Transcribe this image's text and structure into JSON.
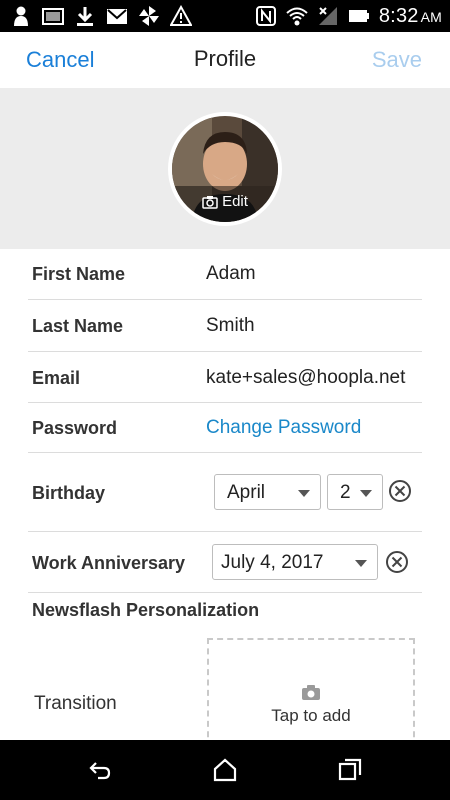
{
  "status_bar": {
    "time": "8:32",
    "ampm": "AM",
    "left_icons": [
      "person-icon",
      "image-icon",
      "download-icon",
      "gmail-icon",
      "pinwheel-icon",
      "warning-icon"
    ],
    "right_icons": [
      "nfc-icon",
      "wifi-icon",
      "signal-icon",
      "battery-icon"
    ]
  },
  "header": {
    "cancel": "Cancel",
    "title": "Profile",
    "save": "Save"
  },
  "avatar": {
    "edit_label": "Edit",
    "icon": "camera-icon"
  },
  "fields": {
    "first_name": {
      "label": "First Name",
      "value": "Adam"
    },
    "last_name": {
      "label": "Last Name",
      "value": "Smith"
    },
    "email": {
      "label": "Email",
      "value": "kate+sales@hoopla.net"
    },
    "password": {
      "label": "Password",
      "value": "Change Password"
    },
    "birthday": {
      "label": "Birthday",
      "month": "April",
      "day": "2"
    },
    "work_anniversary": {
      "label": "Work Anniversary",
      "date": "July 4, 2017"
    }
  },
  "newsflash": {
    "title": "Newsflash Personalization",
    "transition_label": "Transition",
    "tap_to_add": "Tap to add"
  },
  "nav": [
    "back-icon",
    "home-icon",
    "recents-icon"
  ],
  "colors": {
    "accent": "#1a7fd8",
    "save_disabled": "#a9cdee",
    "link": "#1a88c9",
    "band": "#ececec"
  }
}
